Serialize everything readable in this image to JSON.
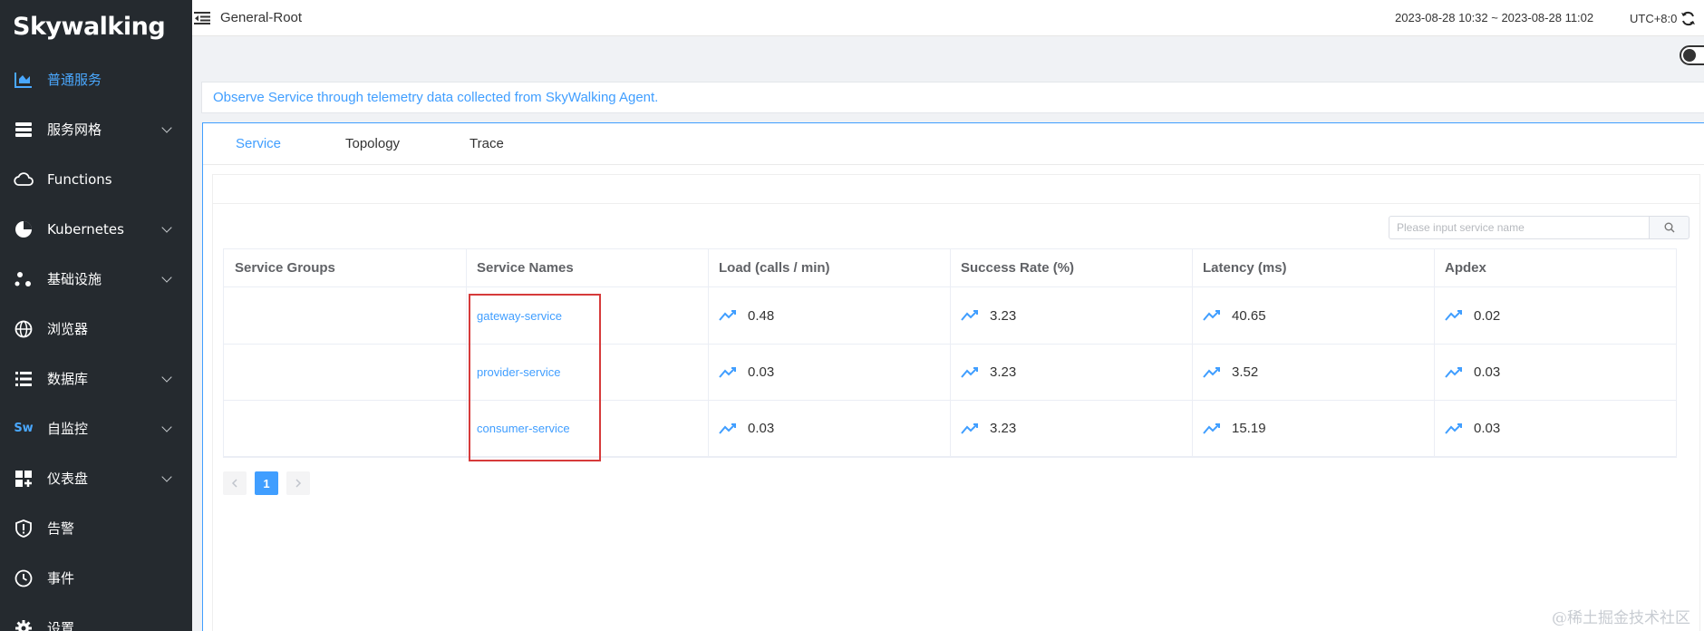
{
  "sidebar": {
    "logo": "Skywalking",
    "items": [
      {
        "label": "普通服务",
        "icon": "bar-chart-icon",
        "active": true,
        "expandable": false
      },
      {
        "label": "服务网格",
        "icon": "server-icon",
        "expandable": true
      },
      {
        "label": "Functions",
        "icon": "cloud-icon",
        "expandable": false
      },
      {
        "label": "Kubernetes",
        "icon": "pie-chart-icon",
        "expandable": true
      },
      {
        "label": "基础设施",
        "icon": "nodes-icon",
        "expandable": true
      },
      {
        "label": "浏览器",
        "icon": "globe-icon",
        "expandable": false
      },
      {
        "label": "数据库",
        "icon": "list-icon",
        "expandable": true
      },
      {
        "label": "自监控",
        "icon": "sw-icon",
        "expandable": true
      },
      {
        "label": "仪表盘",
        "icon": "dashboard-icon",
        "expandable": true
      },
      {
        "label": "告警",
        "icon": "alert-shield-icon",
        "expandable": false
      },
      {
        "label": "事件",
        "icon": "clock-icon",
        "expandable": false
      },
      {
        "label": "设置",
        "icon": "gear-icon",
        "expandable": false
      }
    ]
  },
  "header": {
    "title": "General-Root",
    "time_range": "2023-08-28 10:32 ~ 2023-08-28 11:02",
    "timezone": "UTC+8:0"
  },
  "description": "Observe Service through telemetry data collected from SkyWalking Agent.",
  "tabs": [
    {
      "label": "Service",
      "active": true
    },
    {
      "label": "Topology",
      "active": false
    },
    {
      "label": "Trace",
      "active": false
    }
  ],
  "search": {
    "placeholder": "Please input service name"
  },
  "table": {
    "headers": [
      "Service Groups",
      "Service Names",
      "Load (calls / min)",
      "Success Rate (%)",
      "Latency (ms)",
      "Apdex"
    ],
    "rows": [
      {
        "group": "",
        "name": "gateway-service",
        "load": "0.48",
        "success": "3.23",
        "latency": "40.65",
        "apdex": "0.02"
      },
      {
        "group": "",
        "name": "provider-service",
        "load": "0.03",
        "success": "3.23",
        "latency": "3.52",
        "apdex": "0.03"
      },
      {
        "group": "",
        "name": "consumer-service",
        "load": "0.03",
        "success": "3.23",
        "latency": "15.19",
        "apdex": "0.03"
      }
    ]
  },
  "pagination": {
    "current": "1"
  },
  "watermark": "@稀土掘金技术社区",
  "colors": {
    "accent": "#409eff",
    "sidebar_bg": "#252a2f",
    "highlight": "#d63b3b"
  }
}
